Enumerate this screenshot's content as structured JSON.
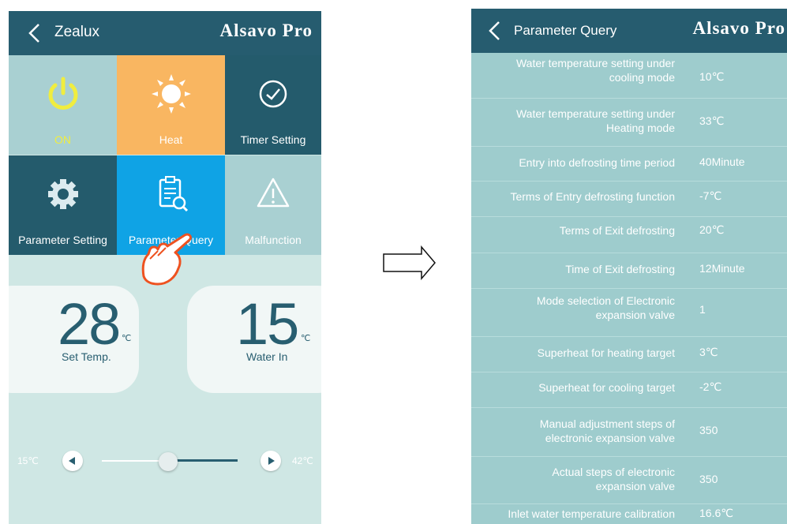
{
  "left_screen": {
    "title": "Zealux",
    "brand": "Alsavo Pro",
    "tiles": [
      {
        "label": "ON",
        "icon": "power-icon"
      },
      {
        "label": "Heat",
        "icon": "sun-icon"
      },
      {
        "label": "Timer Setting",
        "icon": "clock-icon"
      },
      {
        "label": "Parameter Setting",
        "icon": "gear-icon"
      },
      {
        "label": "Parameter Query",
        "icon": "clipboard-search-icon"
      },
      {
        "label": "Malfunction",
        "icon": "warning-icon"
      }
    ],
    "set_temp": {
      "value": "28",
      "unit": "℃",
      "label": "Set Temp."
    },
    "water_in": {
      "value": "15",
      "unit": "℃",
      "label": "Water In"
    },
    "slider": {
      "min_label": "15℃",
      "max_label": "42℃"
    }
  },
  "right_screen": {
    "title": "Parameter Query",
    "brand": "Alsavo Pro",
    "rows": [
      {
        "name": [
          "Water temperature setting under",
          "cooling mode"
        ],
        "value": "10℃"
      },
      {
        "name": [
          "Water temperature setting under",
          "Heating mode"
        ],
        "value": "33℃"
      },
      {
        "name": [
          "Entry into defrosting time period"
        ],
        "value": "40Minute"
      },
      {
        "name": [
          "Terms of Entry defrosting function"
        ],
        "value": "-7℃"
      },
      {
        "name": [
          "Terms of Exit defrosting"
        ],
        "value": "20℃"
      },
      {
        "name": [
          "Time of Exit defrosting"
        ],
        "value": "12Minute"
      },
      {
        "name": [
          "Mode selection of Electronic",
          "expansion valve"
        ],
        "value": "1"
      },
      {
        "name": [
          "Superheat for heating target"
        ],
        "value": "3℃"
      },
      {
        "name": [
          "Superheat for cooling target"
        ],
        "value": "-2℃"
      },
      {
        "name": [
          "Manual adjustment steps of",
          "electronic expansion valve"
        ],
        "value": "350"
      },
      {
        "name": [
          "Actual steps of electronic",
          "expansion valve"
        ],
        "value": "350"
      },
      {
        "name": [
          "Inlet water temperature calibration"
        ],
        "value": "16.6℃"
      }
    ]
  },
  "colors": {
    "header": "#265c6f",
    "on_label": "#f0ed3f",
    "heat_tile": "#f9b661",
    "query_tile": "#0fa3e5",
    "dark_tile": "#245b6c",
    "light_tile": "#a9d0d2",
    "param_bg": "#9ecccd"
  }
}
